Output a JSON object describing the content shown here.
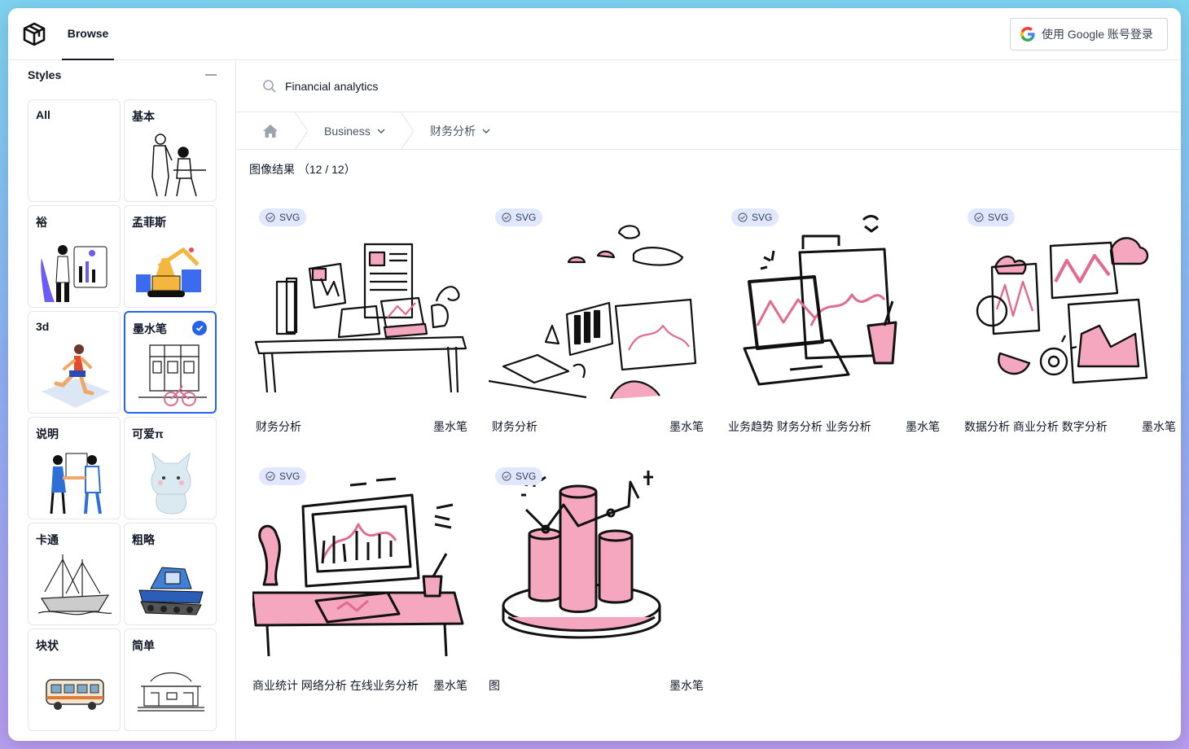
{
  "header": {
    "nav_browse": "Browse",
    "login_label": "使用 Google 账号登录"
  },
  "sidebar": {
    "title": "Styles",
    "styles": [
      {
        "label": "All",
        "selected": false
      },
      {
        "label": "基本",
        "selected": false
      },
      {
        "label": "裕",
        "selected": false
      },
      {
        "label": "孟菲斯",
        "selected": false
      },
      {
        "label": "3d",
        "selected": false
      },
      {
        "label": "墨水笔",
        "selected": true
      },
      {
        "label": "说明",
        "selected": false
      },
      {
        "label": "可爱π",
        "selected": false
      },
      {
        "label": "卡通",
        "selected": false
      },
      {
        "label": "粗略",
        "selected": false
      },
      {
        "label": "块状",
        "selected": false
      },
      {
        "label": "简单",
        "selected": false
      }
    ]
  },
  "search": {
    "value": "Financial analytics"
  },
  "breadcrumb": {
    "items": [
      "Business",
      "财务分析"
    ]
  },
  "results": {
    "label": "图像结果",
    "count": "（12 / 12）",
    "badge": "SVG",
    "cards": [
      {
        "title": "财务分析",
        "style": "墨水笔"
      },
      {
        "title": "财务分析",
        "style": "墨水笔"
      },
      {
        "title": "业务趋势 财务分析 业务分析",
        "style": "墨水笔"
      },
      {
        "title": "数据分析 商业分析 数字分析",
        "style": "墨水笔"
      },
      {
        "title": "商业统计 网络分析 在线业务分析",
        "style": "墨水笔"
      },
      {
        "title": "图",
        "style": "墨水笔"
      }
    ]
  },
  "colors": {
    "accent": "#2563eb",
    "pink": "#f4a7bf",
    "ink": "#111111"
  }
}
